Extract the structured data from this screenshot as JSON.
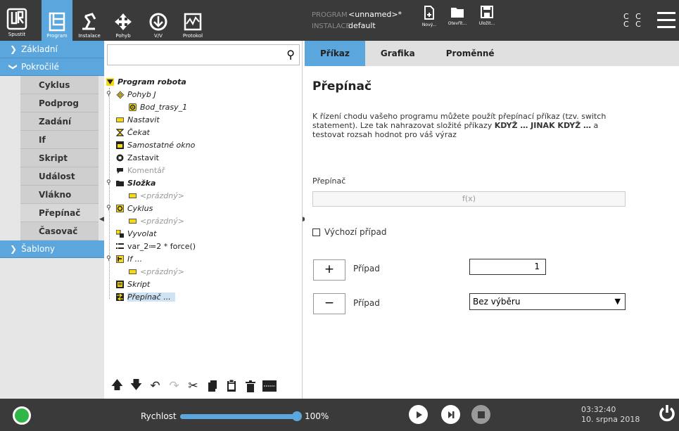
{
  "topbar": {
    "logo_label": "Spustit",
    "nav": [
      {
        "label": "Program",
        "icon": "program-icon"
      },
      {
        "label": "Instalace",
        "icon": "installation-icon"
      },
      {
        "label": "Pohyb",
        "icon": "move-icon"
      },
      {
        "label": "V/V",
        "icon": "io-icon"
      },
      {
        "label": "Protokol",
        "icon": "log-icon"
      }
    ],
    "program_key": "PROGRAM",
    "program_value": "<unnamed>*",
    "installation_key": "INSTALACE",
    "installation_value": "default",
    "file_new": "Nový...",
    "file_open": "Otevřít...",
    "file_save": "Uložit...",
    "cc_line1": "C C",
    "cc_line2": "C C"
  },
  "sidebar": {
    "basic": "Základní",
    "advanced": "Pokročilé",
    "items": [
      "Cyklus",
      "Podprog",
      "Zadání",
      "If",
      "Skript",
      "Událost",
      "Vlákno",
      "Přepínač",
      "Časovač"
    ],
    "templates": "Šablony"
  },
  "tree": {
    "root": "Program robota",
    "nodes": {
      "movej": "Pohyb J",
      "waypoint": "Bod_trasy_1",
      "set": "Nastavit",
      "wait": "Čekat",
      "popup": "Samostatné okno",
      "halt": "Zastavit",
      "comment": "Komentář",
      "folder": "Složka",
      "empty1": "<prázdný>",
      "loop": "Cyklus",
      "empty2": "<prázdný>",
      "call": "Vyvolat",
      "assign": "var_2≔2 * force()",
      "if": "If ...",
      "empty3": "<prázdný>",
      "script": "Skript",
      "switch": "Přepínač ..."
    }
  },
  "tabs": [
    "Příkaz",
    "Grafika",
    "Proměnné"
  ],
  "panel": {
    "title": "Přepínač",
    "desc_a": "K řízení chodu vašeho programu můžete použít přepínací příkaz (tzv. switch statement). Lze tak nahrazovat složité příkazy ",
    "desc_b": "KDYŽ … JINAK KDYŽ …",
    "desc_c": " a testovat rozsah hodnot pro váš výraz",
    "switch_label": "Přepínač",
    "expr_placeholder": "f(x)",
    "default_case": "Výchozí případ",
    "add_symbol": "+",
    "remove_symbol": "−",
    "case_label": "Případ",
    "case_value": "1",
    "case_select": "Bez výběru"
  },
  "bottombar": {
    "speed_label": "Rychlost",
    "speed_value": "100%",
    "speed_fraction": 1.0,
    "time": "03:32:40",
    "date": "10. srpna 2018"
  },
  "colors": {
    "accent": "#5ba7dd",
    "bar": "#3a3a3a",
    "status": "#2fb54a"
  }
}
